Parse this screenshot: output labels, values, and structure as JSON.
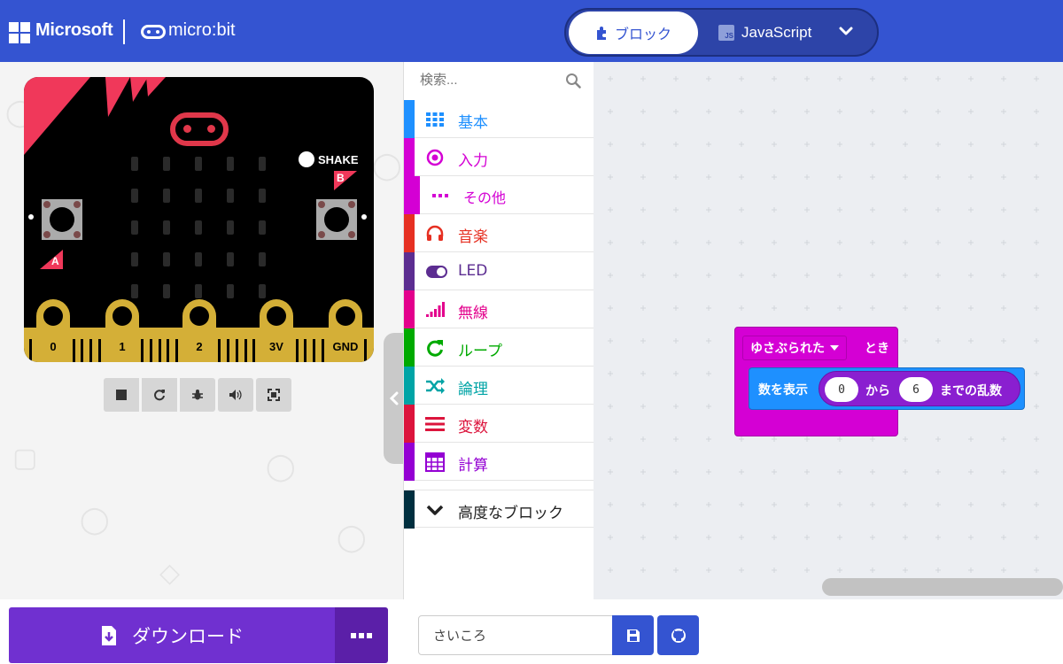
{
  "header": {
    "brand_microsoft": "Microsoft",
    "brand_microbit": "micro:bit",
    "editor_toggle": {
      "blocks_label": "ブロック",
      "javascript_label": "JavaScript",
      "js_badge": "JS",
      "selected": "blocks"
    },
    "colors": {
      "bar": "#3454d1"
    }
  },
  "simulator": {
    "shake_label": "SHAKE",
    "button_a": "A",
    "button_b": "B",
    "pins": [
      "0",
      "1",
      "2",
      "3V",
      "GND"
    ],
    "controls": [
      "stop-icon",
      "restart-icon",
      "debug-icon",
      "mute-icon",
      "fullscreen-icon"
    ]
  },
  "toolbox": {
    "search_placeholder": "検索...",
    "categories": [
      {
        "label": "基本",
        "color": "#1e90ff",
        "icon": "grid-icon"
      },
      {
        "label": "入力",
        "color": "#d400d4",
        "icon": "target-icon"
      },
      {
        "label": "その他",
        "color": "#d400d4",
        "icon": "more-dots-icon",
        "sub": true
      },
      {
        "label": "音楽",
        "color": "#e63022",
        "icon": "headphones-icon"
      },
      {
        "label": "LED",
        "color": "#5c2d91",
        "icon": "toggle-icon"
      },
      {
        "label": "無線",
        "color": "#e3008c",
        "icon": "signal-bars-icon"
      },
      {
        "label": "ループ",
        "color": "#00aa00",
        "icon": "refresh-icon"
      },
      {
        "label": "論理",
        "color": "#00a4a6",
        "icon": "shuffle-icon"
      },
      {
        "label": "変数",
        "color": "#dc143c",
        "icon": "lines-icon"
      },
      {
        "label": "計算",
        "color": "#9400d3",
        "icon": "calculator-icon"
      }
    ],
    "advanced_label": "高度なブロック",
    "advanced_color": "#002f3f"
  },
  "workspace": {
    "event_block": {
      "dropdown_value": "ゆさぶられた",
      "suffix": "とき",
      "color": "#d400d4"
    },
    "show_number_block": {
      "label": "数を表示",
      "color": "#1e90ff"
    },
    "random_block": {
      "from_value": "0",
      "from_label": "から",
      "to_value": "6",
      "to_label": "までの乱数",
      "color": "#8a1fd0"
    }
  },
  "bottom_bar": {
    "download_label": "ダウンロード",
    "project_name": "さいころ",
    "download_color": "#7030d0"
  }
}
